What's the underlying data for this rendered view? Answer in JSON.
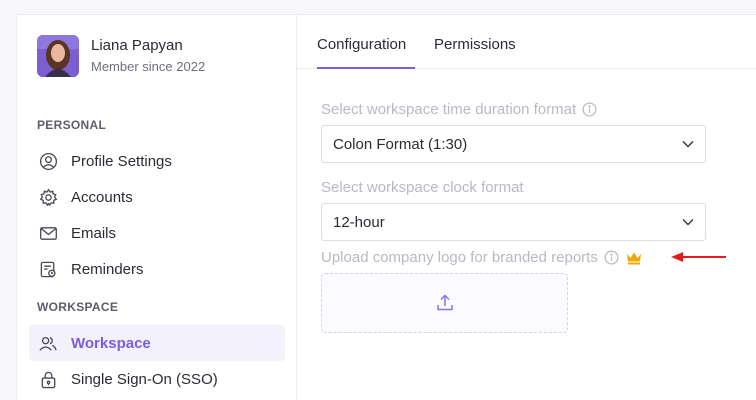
{
  "profile": {
    "name": "Liana Papyan",
    "since": "Member since 2022"
  },
  "sidebar": {
    "personal_label": "PERSONAL",
    "workspace_label": "WORKSPACE",
    "items": [
      {
        "label": "Profile Settings",
        "icon": "user-circle-icon"
      },
      {
        "label": "Accounts",
        "icon": "gear-icon"
      },
      {
        "label": "Emails",
        "icon": "envelope-icon"
      },
      {
        "label": "Reminders",
        "icon": "reminder-calendar-icon"
      },
      {
        "label": "Workspace",
        "icon": "users-icon",
        "active": true
      },
      {
        "label": "Single Sign-On (SSO)",
        "icon": "lock-icon"
      }
    ]
  },
  "tabs": [
    {
      "label": "Configuration",
      "active": true
    },
    {
      "label": "Permissions",
      "active": false
    }
  ],
  "form": {
    "duration_label": "Select workspace time duration format",
    "duration_value": "Colon Format (1:30)",
    "clock_label": "Select workspace clock format",
    "clock_value": "12-hour",
    "logo_label": "Upload company logo for branded reports"
  },
  "colors": {
    "accent": "#7c5ce6",
    "premium": "#f0a800",
    "annotation": "#e02020"
  }
}
